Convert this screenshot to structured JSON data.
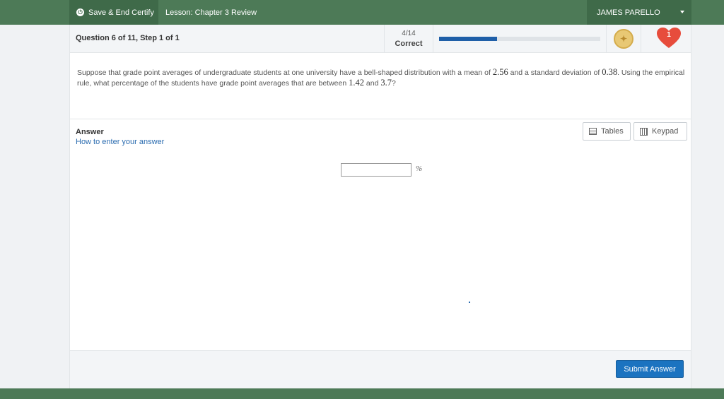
{
  "topbar": {
    "save_label": "Save & End Certify",
    "lesson_label": "Lesson: Chapter 3 Review",
    "user_name": "JAMES PARELLO"
  },
  "question_header": {
    "step_text": "Question 6 of 11, Step 1 of 1",
    "score": "4/14",
    "score_status": "Correct",
    "progress_fraction": 0.36,
    "lives": "1"
  },
  "question": {
    "part1": "Suppose that grade point averages of undergraduate students at one university have a bell-shaped distribution with a mean of ",
    "mean": "2.56",
    "part2": " and a standard deviation of ",
    "sd": "0.38",
    "part3": ". Using the empirical rule, what percentage of the students have grade point averages that are between ",
    "low": "1.42",
    "part4": " and ",
    "high": "3.7",
    "part5": "?"
  },
  "answer": {
    "label": "Answer",
    "help_link": "How to enter your answer",
    "tables_label": "Tables",
    "keypad_label": "Keypad",
    "input_value": "",
    "unit": "%"
  },
  "footer": {
    "submit_label": "Submit Answer"
  },
  "colors": {
    "brand_green": "#4d7a57",
    "progress_blue": "#1f5fa8",
    "submit_blue": "#1b73c0",
    "heart_red": "#e74c3c"
  },
  "icons": [
    "power-icon",
    "caret-down-icon",
    "coin-badge-icon",
    "heart-icon",
    "table-icon",
    "calculator-icon"
  ]
}
